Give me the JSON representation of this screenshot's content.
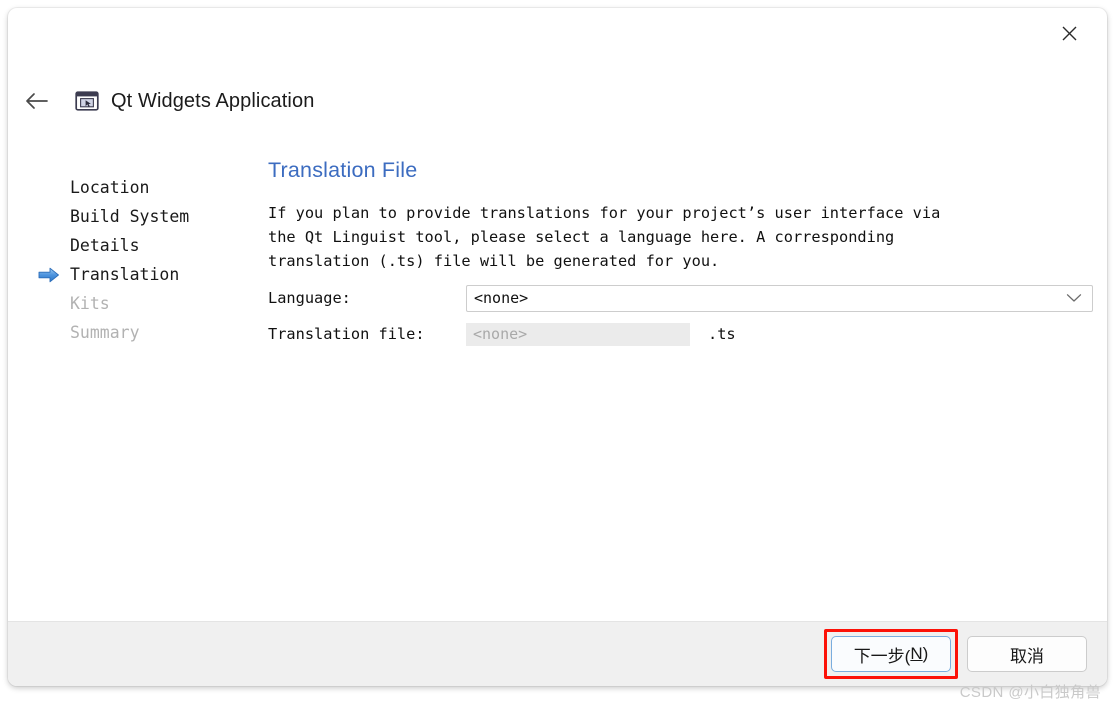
{
  "window": {
    "close_label": "✕",
    "back_label": "←",
    "app_title": "Qt Widgets Application",
    "app_icon": "window-cursor-icon"
  },
  "steps": [
    {
      "label": "Location",
      "state": "done"
    },
    {
      "label": "Build System",
      "state": "done"
    },
    {
      "label": "Details",
      "state": "done"
    },
    {
      "label": "Translation",
      "state": "current"
    },
    {
      "label": "Kits",
      "state": "upcoming"
    },
    {
      "label": "Summary",
      "state": "upcoming"
    }
  ],
  "pane": {
    "title": "Translation File",
    "description": "If you plan to provide translations for your project’s user interface via\nthe Qt Linguist tool, please select a language here. A corresponding\ntranslation (.ts) file will be generated for you.",
    "language_label": "Language:",
    "language_value": "<none>",
    "language_options": [
      "<none>"
    ],
    "translation_file_label": "Translation file:",
    "translation_file_value": "<none>",
    "translation_file_suffix": ".ts"
  },
  "footer": {
    "next_prefix": "下一步(",
    "next_mnemonic": "N",
    "next_suffix": ")",
    "cancel_label": "取消"
  },
  "watermark": {
    "text": "CSDN @小白独角兽"
  },
  "colors": {
    "accent_blue": "#3c6cc0",
    "highlight_red": "#fc1107",
    "focus_blue": "#7aadde",
    "disabled_grey": "#b2b2b2"
  }
}
